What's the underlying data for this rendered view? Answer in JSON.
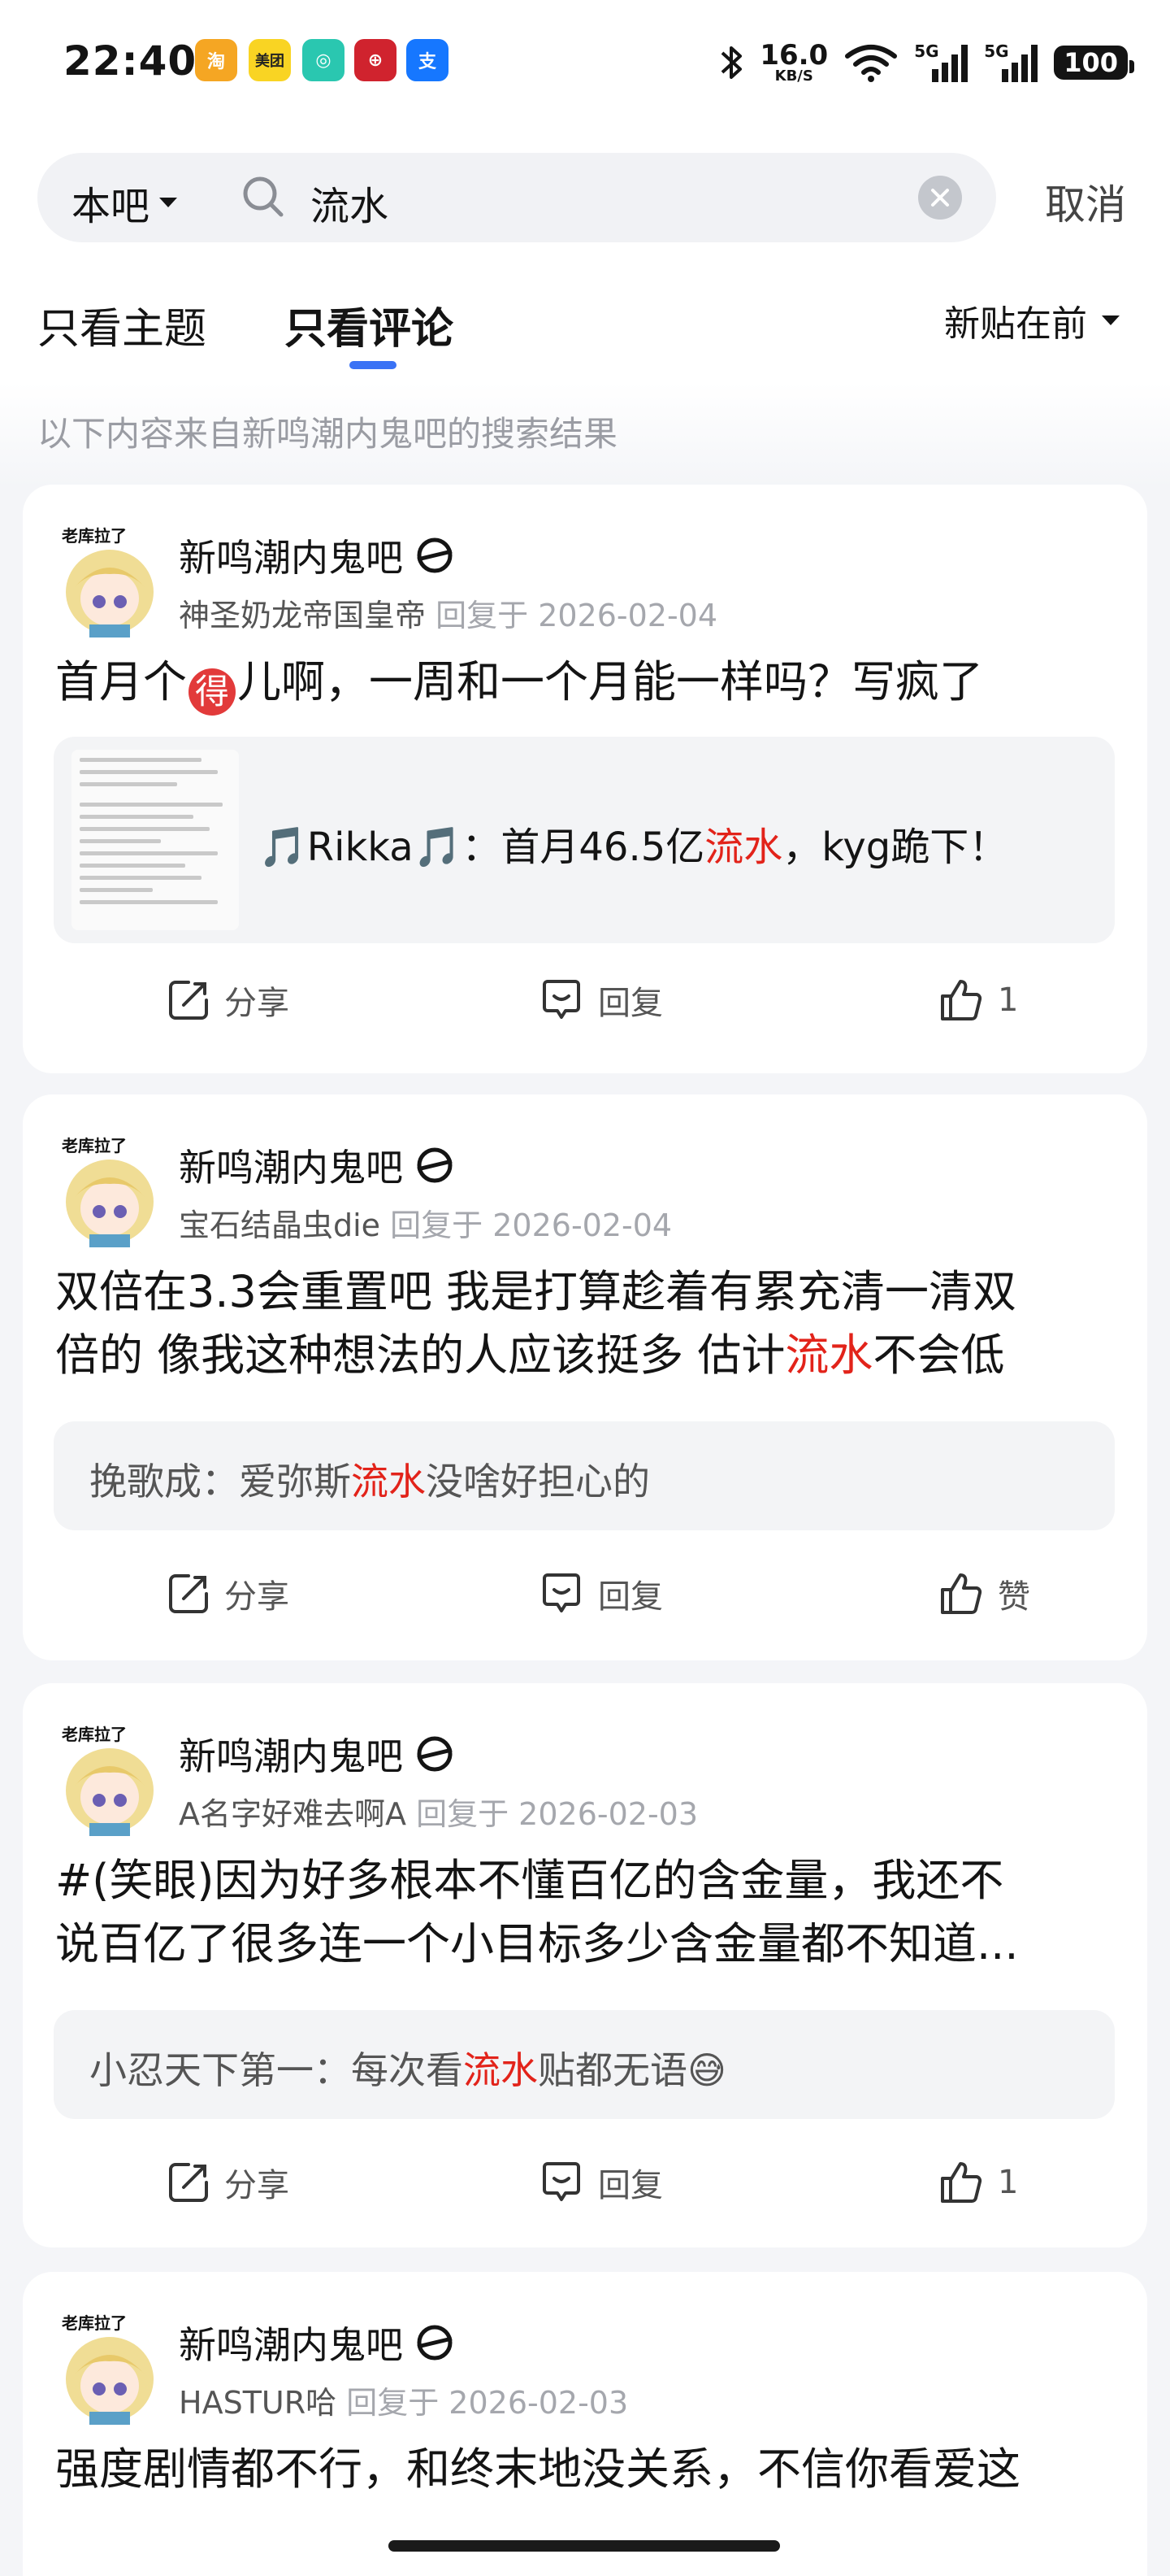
{
  "status_bar": {
    "time": "22:40",
    "notifications": [
      {
        "icon": "taobao-app-icon",
        "color": "#f5a623",
        "glyph": "淘"
      },
      {
        "icon": "meituan-app-icon",
        "color": "#f9d423",
        "glyph": "美团"
      },
      {
        "icon": "chat-app-icon",
        "color": "#2ac7b0",
        "glyph": "◎"
      },
      {
        "icon": "bank-app-icon",
        "color": "#d0232e",
        "glyph": "⊕"
      },
      {
        "icon": "alipay-app-icon",
        "color": "#1677ff",
        "glyph": "支"
      }
    ],
    "net_speed": "16.0",
    "net_unit": "KB/S",
    "net1": "5G",
    "net2": "5G",
    "battery": "100"
  },
  "search": {
    "scope": "本吧",
    "query": "流水",
    "cancel_label": "取消"
  },
  "tabs": {
    "topic": "只看主题",
    "comment": "只看评论",
    "active": "comment"
  },
  "sort_label": "新贴在前",
  "source_tip": "以下内容来自新鸣潮内鬼吧的搜索结果",
  "colors": {
    "accent": "#3a72f5",
    "highlight": "#e2231a"
  },
  "posts": [
    {
      "forum": "新鸣潮内鬼吧",
      "author": "神圣奶龙帝国皇帝",
      "reply_label": "回复于 2026-02-04",
      "body_a": "首月个",
      "body_badge": "得",
      "body_b": "儿啊，一周和一个月能一样吗？写疯了",
      "quote_prefix": "🎵Rikka🎵：首月46.5亿",
      "quote_hl": "流水",
      "quote_suffix": "，kyg跪下！",
      "actions": {
        "share": "分享",
        "comment": "回复",
        "like": "1"
      }
    },
    {
      "forum": "新鸣潮内鬼吧",
      "author": "宝石结晶虫die",
      "reply_label": "回复于 2026-02-04",
      "line1": "双倍在3.3会重置吧 我是打算趁着有累充清一清双",
      "line2_a": "倍的 像我这种想法的人应该挺多 估计",
      "line2_hl": "流水",
      "line2_b": "不会低",
      "quote_prefix": "挽歌成：爱弥斯",
      "quote_hl": "流水",
      "quote_suffix": "没啥好担心的",
      "actions": {
        "share": "分享",
        "comment": "回复",
        "like": "赞"
      }
    },
    {
      "forum": "新鸣潮内鬼吧",
      "author": "A名字好难去啊A",
      "reply_label": "回复于 2026-02-03",
      "line1": "#(笑眼)因为好多根本不懂百亿的含金量，我还不",
      "line2": "说百亿了很多连一个小目标多少含金量都不知道...",
      "quote_prefix": "小忍天下第一：每次看",
      "quote_hl": "流水",
      "quote_suffix": "贴都无语😅",
      "actions": {
        "share": "分享",
        "comment": "回复",
        "like": "1"
      }
    },
    {
      "forum": "新鸣潮内鬼吧",
      "author": "HASTUR哈",
      "reply_label": "回复于 2026-02-03",
      "line1": "强度剧情都不行，和终末地没关系，不信你看爱这"
    }
  ]
}
